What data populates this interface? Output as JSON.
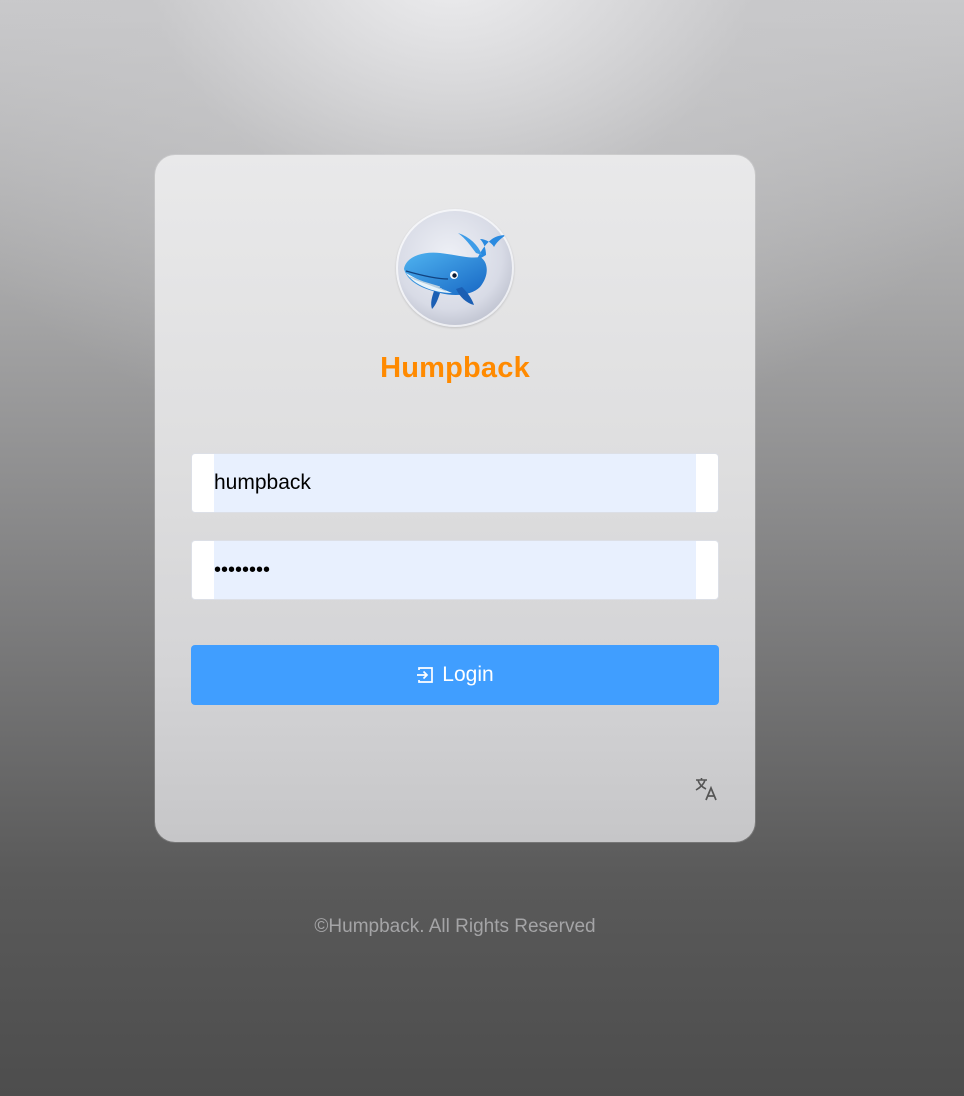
{
  "brand": {
    "name": "Humpback",
    "color": "#ff8a00",
    "logo_icon": "humpback-whale-icon"
  },
  "form": {
    "username": {
      "value": "humpback",
      "autofill_bg": "#e8f0fe"
    },
    "password": {
      "value": "humpback"
    },
    "login": {
      "label": "Login",
      "icon": "login-arrow-icon",
      "color": "#409eff"
    },
    "language_icon": "translate-icon"
  },
  "footer": {
    "copyright": "©Humpback. All Rights Reserved"
  }
}
